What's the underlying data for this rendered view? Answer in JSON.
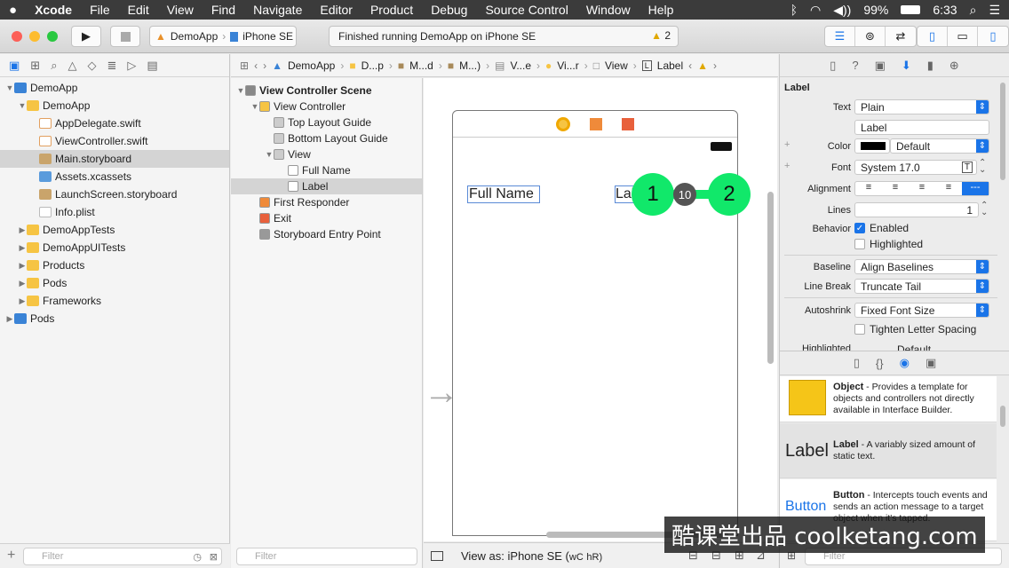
{
  "menubar": {
    "apple": "",
    "items": [
      "Xcode",
      "File",
      "Edit",
      "View",
      "Find",
      "Navigate",
      "Editor",
      "Product",
      "Debug",
      "Source Control",
      "Window",
      "Help"
    ],
    "battery": "99%",
    "time": "6:33"
  },
  "toolbar": {
    "scheme_project": "DemoApp",
    "scheme_device": "iPhone SE",
    "activity_text": "Finished running DemoApp on iPhone SE",
    "warning_count": "2"
  },
  "navigator": {
    "tree": [
      {
        "label": "DemoApp",
        "type": "project",
        "depth": 0,
        "open": true
      },
      {
        "label": "DemoApp",
        "type": "folder",
        "depth": 1,
        "open": true
      },
      {
        "label": "AppDelegate.swift",
        "type": "swift",
        "depth": 2
      },
      {
        "label": "ViewController.swift",
        "type": "swift",
        "depth": 2
      },
      {
        "label": "Main.storyboard",
        "type": "storyboard",
        "depth": 2,
        "selected": true
      },
      {
        "label": "Assets.xcassets",
        "type": "assets",
        "depth": 2
      },
      {
        "label": "LaunchScreen.storyboard",
        "type": "storyboard",
        "depth": 2
      },
      {
        "label": "Info.plist",
        "type": "plist",
        "depth": 2
      },
      {
        "label": "DemoAppTests",
        "type": "folder",
        "depth": 1
      },
      {
        "label": "DemoAppUITests",
        "type": "folder",
        "depth": 1
      },
      {
        "label": "Products",
        "type": "folder",
        "depth": 1
      },
      {
        "label": "Pods",
        "type": "folder",
        "depth": 1
      },
      {
        "label": "Frameworks",
        "type": "folder",
        "depth": 1
      },
      {
        "label": "Pods",
        "type": "project",
        "depth": 0
      }
    ],
    "filter_placeholder": "Filter"
  },
  "jumpbar": [
    "DemoApp",
    "D...p",
    "M...d",
    "M...)",
    "V...e",
    "Vi...r",
    "View",
    "Label"
  ],
  "outline": {
    "items": [
      {
        "label": "View Controller Scene",
        "depth": 0,
        "bold": true
      },
      {
        "label": "View Controller",
        "depth": 1
      },
      {
        "label": "Top Layout Guide",
        "depth": 2
      },
      {
        "label": "Bottom Layout Guide",
        "depth": 2
      },
      {
        "label": "View",
        "depth": 2
      },
      {
        "label": "Full Name",
        "depth": 3
      },
      {
        "label": "Label",
        "depth": 3,
        "selected": true
      },
      {
        "label": "First Responder",
        "depth": 1
      },
      {
        "label": "Exit",
        "depth": 1
      },
      {
        "label": "Storyboard Entry Point",
        "depth": 1
      }
    ],
    "filter_placeholder": "Filter"
  },
  "canvas": {
    "fullname_text": "Full Name",
    "label_text": "Label",
    "marker1": "1",
    "marker2": "2",
    "distance": "10",
    "view_as": "View as: iPhone SE (",
    "wc": "wC",
    "hr": "hR)"
  },
  "inspector": {
    "header": "Label",
    "text_label": "Text",
    "text_value": "Plain",
    "text_content": "Label",
    "color_label": "Color",
    "color_value": "Default",
    "font_label": "Font",
    "font_value": "System 17.0",
    "alignment_label": "Alignment",
    "lines_label": "Lines",
    "lines_value": "1",
    "behavior_label": "Behavior",
    "enabled_label": "Enabled",
    "highlighted_label": "Highlighted",
    "baseline_label": "Baseline",
    "baseline_value": "Align Baselines",
    "linebreak_label": "Line Break",
    "linebreak_value": "Truncate Tail",
    "autoshrink_label": "Autoshrink",
    "autoshrink_value": "Fixed Font Size",
    "tighten_label": "Tighten Letter Spacing",
    "highlighted2_label": "Highlighted",
    "highlighted2_value": "Default"
  },
  "library": [
    {
      "thumb": "",
      "title": "Object",
      "desc": " - Provides a template for objects and controllers not directly available in Interface Builder."
    },
    {
      "thumb": "Label",
      "title": "Label",
      "desc": " - A variably sized amount of static text."
    },
    {
      "thumb": "Button",
      "title": "Button",
      "desc": " - Intercepts touch events and sends an action message to a target object when it's tapped."
    }
  ],
  "library_filter_placeholder": "Filter",
  "watermark": "酷课堂出品 coolketang.com",
  "colors": {
    "accent": "#1a74e8",
    "marker": "#11e86a"
  }
}
